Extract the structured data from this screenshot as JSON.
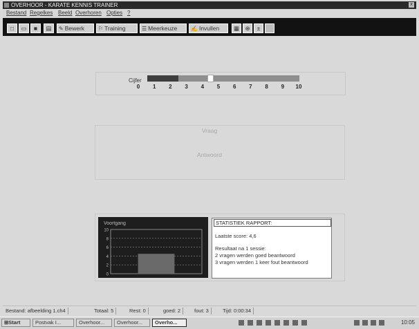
{
  "window": {
    "title": "OVERHOOR - KARATE KENNIS TRAINER",
    "close": "x"
  },
  "menu": [
    "Bestand",
    "Regelkes",
    "Beeld",
    "Overhoren",
    "Opties",
    "?"
  ],
  "toolbar": {
    "bewerk": "Bewerk",
    "training": "Training",
    "meerkeuze": "Meerkeuze",
    "invullen": "Invullen"
  },
  "cijfer": {
    "label": "Cijfer",
    "ticks": [
      "0",
      "1",
      "2",
      "3",
      "4",
      "5",
      "6",
      "7",
      "8",
      "9",
      "10"
    ],
    "value": 4.5,
    "marker": 4.5
  },
  "question": {
    "vraag": "Vraag",
    "antwoord": "Antwoord"
  },
  "chart_data": {
    "type": "area",
    "title": "Voortgang",
    "ylim": [
      0,
      10
    ],
    "ytick_labels": [
      "10",
      "8",
      "6",
      "4",
      "2",
      "0"
    ],
    "x": [
      1
    ],
    "values": [
      4.5
    ],
    "colors": {
      "background": "#1e1e1e",
      "fill": "#6a6a6a",
      "grid": "#8a8a8a"
    }
  },
  "report": {
    "title": "STATISTIEK RAPPORT:",
    "lines": [
      "Laatste score: 4,6",
      "Resultaat na 1 sessie:",
      "2 vragen werden goed beantwoord",
      "3 vragen werden 1 keer fout beantwoord"
    ]
  },
  "status": {
    "bestand": "Bestand: afbeelding 1.ch4",
    "totaal": "Totaal: 5",
    "rest": "Rest: 0",
    "goed": "goed: 2",
    "fout": "fout: 3",
    "tijd": "Tijd: 0:00:34"
  },
  "taskbar": {
    "start": "Start",
    "tasks": [
      "Postvak I...",
      "Overhoor...",
      "Overhoor...",
      "Overho..."
    ],
    "clock": "10:05"
  }
}
